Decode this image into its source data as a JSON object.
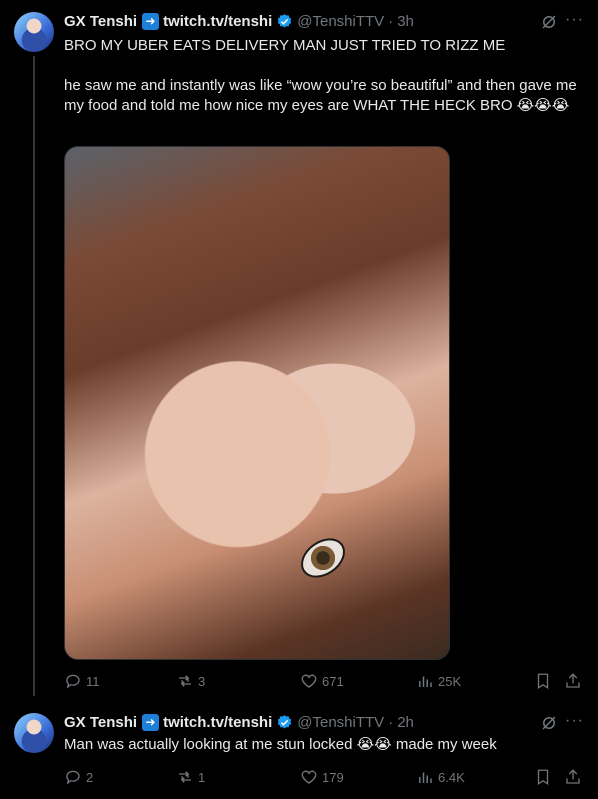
{
  "tweets": [
    {
      "name": "GX Tenshi",
      "link": "twitch.tv/tenshi",
      "handle": "@TenshiTTV",
      "time": "3h",
      "line1": "BRO MY UBER EATS DELIVERY MAN JUST TRIED TO RIZZ ME",
      "line2": "he saw me and instantly was like “wow you’re so beautiful” and then gave me my food and told me how nice my eyes are WHAT THE HECK BRO 😭😭😭",
      "replies": "11",
      "reposts": "3",
      "likes": "671",
      "views": "25K"
    },
    {
      "name": "GX Tenshi",
      "link": "twitch.tv/tenshi",
      "handle": "@TenshiTTV",
      "time": "2h",
      "line1": "Man was actually looking at me stun locked 😭😭 made my week",
      "replies": "2",
      "reposts": "1",
      "likes": "179",
      "views": "6.4K"
    }
  ],
  "icons": {
    "reply": "reply-icon",
    "repost": "repost-icon",
    "like": "heart-icon",
    "views": "views-chart-icon",
    "bookmark": "bookmark-icon",
    "share": "share-icon",
    "verified": "verified-badge-icon",
    "grok": "grok-icon",
    "more": "more-icon"
  },
  "colors": {
    "background": "#000000",
    "text": "#e7e9ea",
    "muted": "#71767b",
    "verified": "#1d9bf0"
  }
}
